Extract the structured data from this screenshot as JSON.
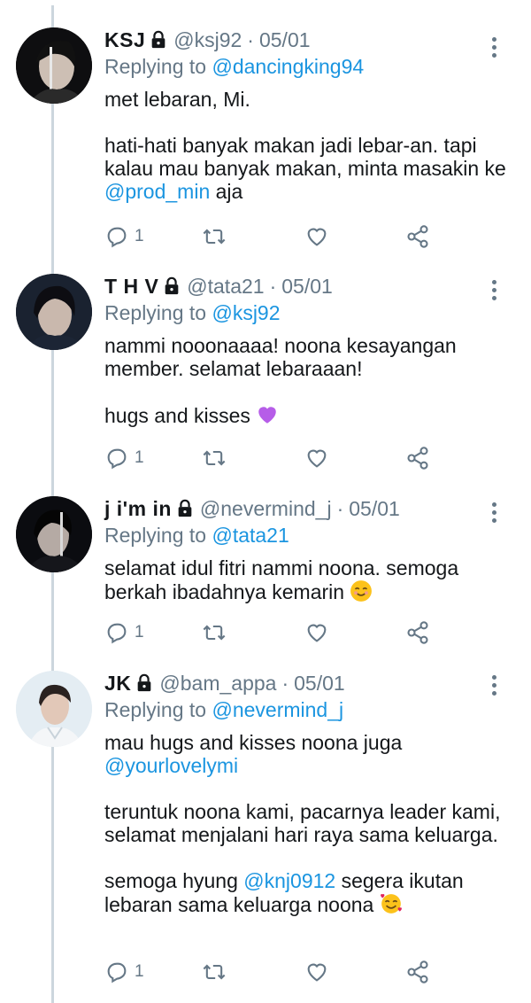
{
  "tweets": [
    {
      "name": "KSJ",
      "handle": "@ksj92",
      "separator": "·",
      "date": "05/01",
      "replying_prefix": "Replying to ",
      "replying_to": "@dancingking94",
      "paragraphs": [
        [
          "met lebaran, Mi."
        ],
        [
          "hati-hati banyak makan jadi lebar-an. tapi kalau mau banyak makan, minta masakin ke ",
          "@prod_min",
          " aja"
        ]
      ],
      "reply_count": "1"
    },
    {
      "name": "T H V",
      "handle": "@tata21",
      "separator": "·",
      "date": "05/01",
      "replying_prefix": "Replying to ",
      "replying_to": "@ksj92",
      "paragraphs": [
        [
          "nammi nooonaaaa! noona kesayangan member. selamat lebaraaan!"
        ],
        [
          "hugs and kisses "
        ]
      ],
      "reply_count": "1"
    },
    {
      "name": "j i'm in",
      "handle": "@nevermind_j",
      "separator": "·",
      "date": "05/01",
      "replying_prefix": "Replying to ",
      "replying_to": "@tata21",
      "paragraphs": [
        [
          "selamat idul fitri nammi noona. semoga berkah ibadahnya kemarin "
        ]
      ],
      "reply_count": "1"
    },
    {
      "name": "JK",
      "handle": "@bam_appa",
      "separator": "·",
      "date": "05/01",
      "replying_prefix": "Replying to ",
      "replying_to": "@nevermind_j",
      "paragraphs": [
        [
          "mau hugs and kisses noona juga ",
          "@yourlovelymi"
        ],
        [
          "teruntuk noona kami, pacarnya leader kami, selamat menjalani hari raya sama keluarga."
        ],
        [
          "semoga hyung ",
          "@knj0912",
          " segera ikutan lebaran sama keluarga noona "
        ]
      ],
      "reply_count": "1"
    }
  ],
  "icons": {
    "lock": "lock-icon",
    "reply": "reply-icon",
    "retweet": "retweet-icon",
    "like": "heart-icon",
    "share": "share-icon",
    "more": "more-vertical-icon"
  },
  "colors": {
    "text": "#14171a",
    "muted": "#657786",
    "link": "#1b95e0",
    "thread_line": "#ccd6dd"
  }
}
